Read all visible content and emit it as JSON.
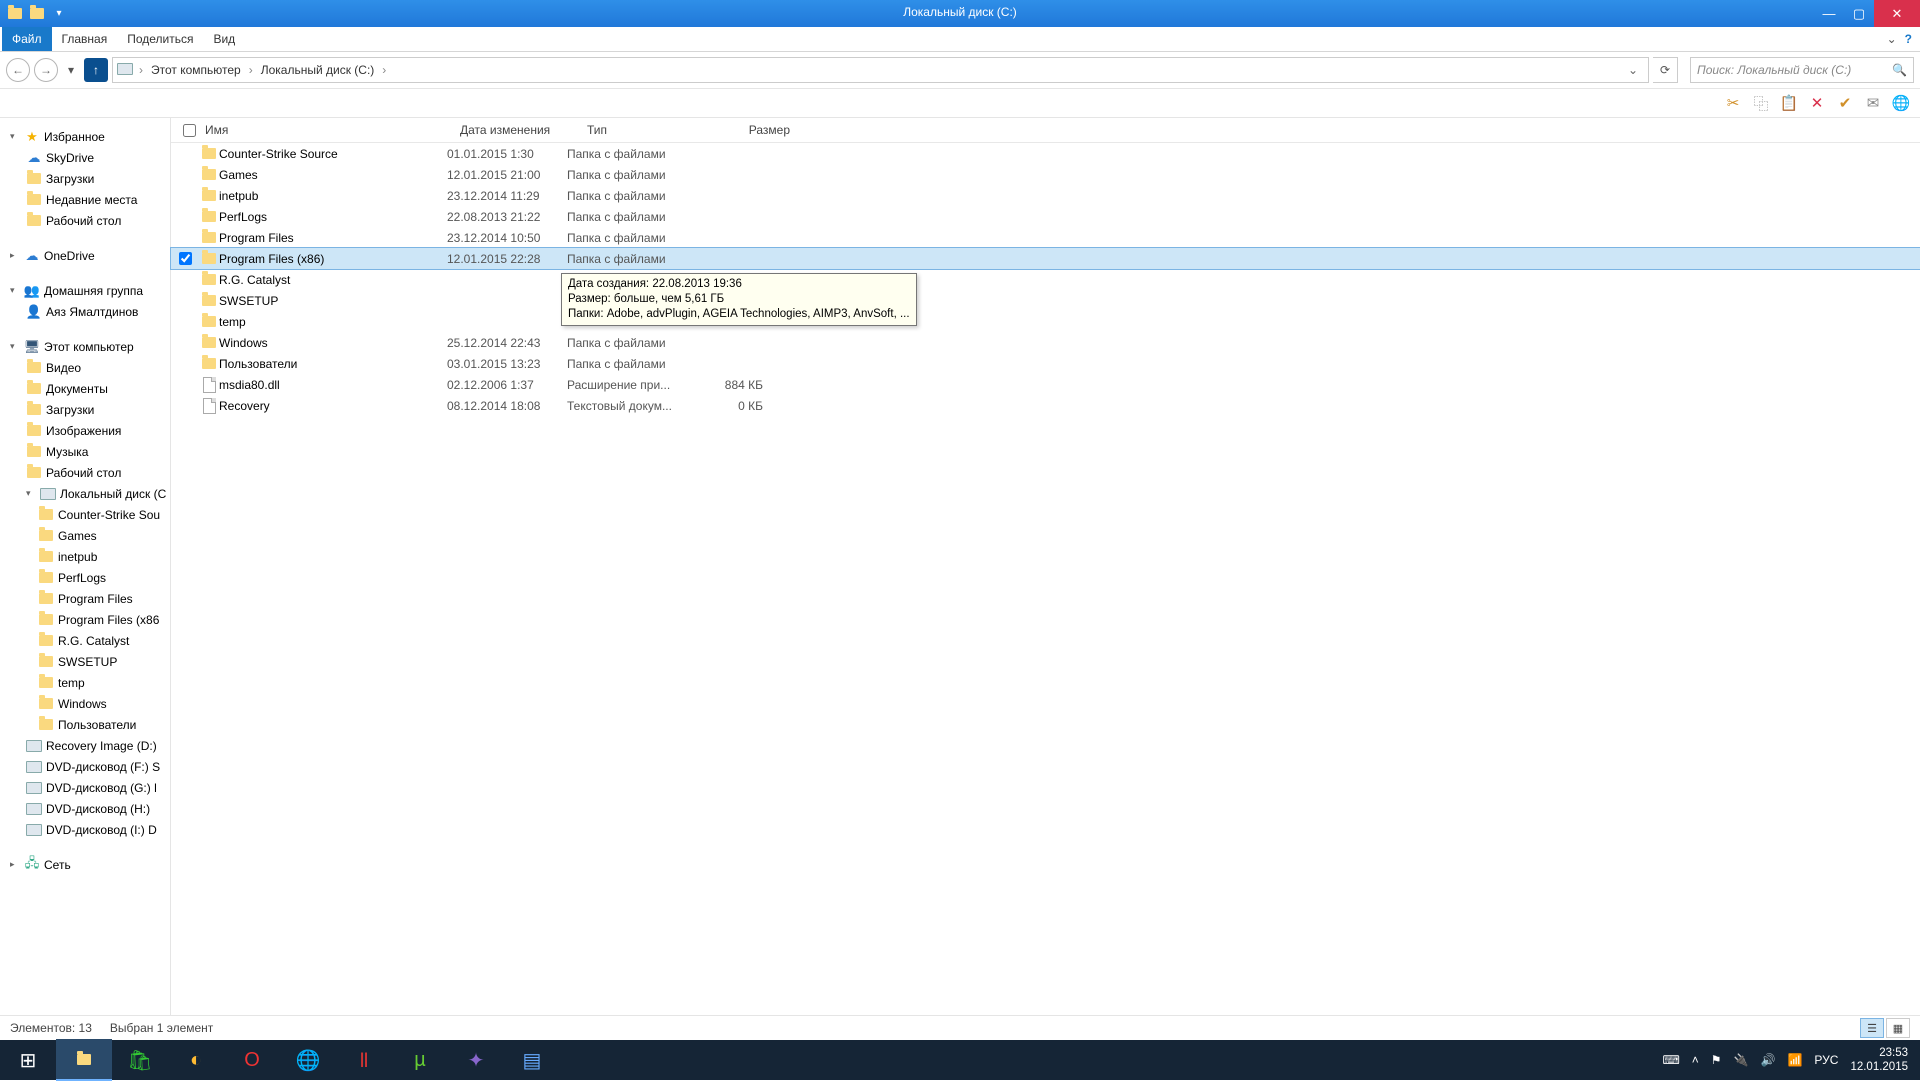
{
  "window": {
    "title": "Локальный диск (C:)"
  },
  "ribbon": {
    "file": "Файл",
    "home": "Главная",
    "share": "Поделиться",
    "view": "Вид"
  },
  "breadcrumb": {
    "root": "Этот компьютер",
    "drive": "Локальный диск (C:)"
  },
  "search": {
    "placeholder": "Поиск: Локальный диск (C:)"
  },
  "columns": {
    "name": "Имя",
    "date": "Дата изменения",
    "type": "Тип",
    "size": "Размер"
  },
  "nav": {
    "favorites": "Избранное",
    "fav_items": [
      "SkyDrive",
      "Загрузки",
      "Недавние места",
      "Рабочий стол"
    ],
    "onedrive": "OneDrive",
    "homegroup": "Домашняя группа",
    "homegroup_user": "Аяз Ямалтдинов",
    "computer": "Этот компьютер",
    "computer_items": [
      "Видео",
      "Документы",
      "Загрузки",
      "Изображения",
      "Музыка",
      "Рабочий стол"
    ],
    "local_disk": "Локальный диск (C",
    "local_disk_children": [
      "Counter-Strike Sou",
      "Games",
      "inetpub",
      "PerfLogs",
      "Program Files",
      "Program Files (x86",
      "R.G. Catalyst",
      "SWSETUP",
      "temp",
      "Windows",
      "Пользователи"
    ],
    "other_drives": [
      "Recovery Image (D:)",
      "DVD-дисковод (F:) S",
      "DVD-дисковод (G:) l",
      "DVD-дисковод (H:)",
      "DVD-дисковод (I:) D"
    ],
    "network": "Сеть"
  },
  "files": [
    {
      "name": "Counter-Strike Source",
      "date": "01.01.2015 1:30",
      "type": "Папка с файлами",
      "size": "",
      "icon": "folder"
    },
    {
      "name": "Games",
      "date": "12.01.2015 21:00",
      "type": "Папка с файлами",
      "size": "",
      "icon": "folder"
    },
    {
      "name": "inetpub",
      "date": "23.12.2014 11:29",
      "type": "Папка с файлами",
      "size": "",
      "icon": "folder"
    },
    {
      "name": "PerfLogs",
      "date": "22.08.2013 21:22",
      "type": "Папка с файлами",
      "size": "",
      "icon": "folder"
    },
    {
      "name": "Program Files",
      "date": "23.12.2014 10:50",
      "type": "Папка с файлами",
      "size": "",
      "icon": "folder"
    },
    {
      "name": "Program Files (x86)",
      "date": "12.01.2015 22:28",
      "type": "Папка с файлами",
      "size": "",
      "icon": "folder",
      "selected": true,
      "checked": true
    },
    {
      "name": "R.G. Catalyst",
      "date": "",
      "type": "",
      "size": "",
      "icon": "folder"
    },
    {
      "name": "SWSETUP",
      "date": "",
      "type": "",
      "size": "",
      "icon": "folder"
    },
    {
      "name": "temp",
      "date": "",
      "type": "",
      "size": "",
      "icon": "folder"
    },
    {
      "name": "Windows",
      "date": "25.12.2014 22:43",
      "type": "Папка с файлами",
      "size": "",
      "icon": "folder"
    },
    {
      "name": "Пользователи",
      "date": "03.01.2015 13:23",
      "type": "Папка с файлами",
      "size": "",
      "icon": "folder"
    },
    {
      "name": "msdia80.dll",
      "date": "02.12.2006 1:37",
      "type": "Расширение при...",
      "size": "884 КБ",
      "icon": "file"
    },
    {
      "name": "Recovery",
      "date": "08.12.2014 18:08",
      "type": "Текстовый докум...",
      "size": "0 КБ",
      "icon": "file"
    }
  ],
  "tooltip": {
    "line1": "Дата создания: 22.08.2013 19:36",
    "line2": "Размер: больше, чем 5,61 ГБ",
    "line3": "Папки: Adobe, advPlugin, AGEIA Technologies, AIMP3, AnvSoft, ..."
  },
  "status": {
    "count": "Элементов: 13",
    "selected": "Выбран 1 элемент"
  },
  "tray": {
    "lang": "РУС",
    "time": "23:53",
    "date": "12.01.2015"
  }
}
